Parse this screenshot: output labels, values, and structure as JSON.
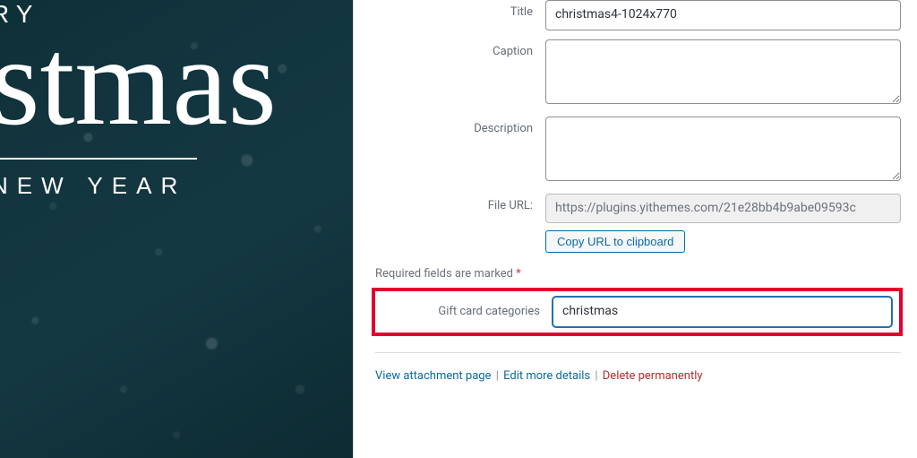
{
  "preview": {
    "line1": "RY",
    "script": "stmas",
    "line2": "NEW YEAR"
  },
  "fields": {
    "title_label": "Title",
    "title_value": "christmas4-1024x770",
    "caption_label": "Caption",
    "caption_value": "",
    "description_label": "Description",
    "description_value": "",
    "fileurl_label": "File URL:",
    "fileurl_value": "https://plugins.yithemes.com/21e28bb4b9abe09593c",
    "copy_btn": "Copy URL to clipboard",
    "required_note": "Required fields are marked ",
    "required_mark": "*",
    "gift_label": "Gift card categories",
    "gift_value": "christmas"
  },
  "links": {
    "view": "View attachment page",
    "edit": "Edit more details",
    "delete": "Delete permanently",
    "sep": " | "
  }
}
